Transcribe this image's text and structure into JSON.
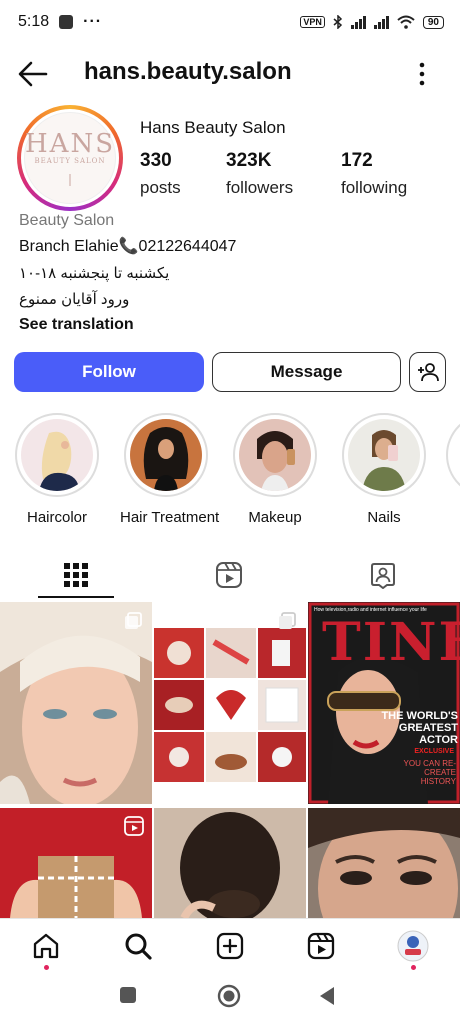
{
  "status_bar": {
    "time": "5:18",
    "dots": "···",
    "vpn": "VPN",
    "battery": "90"
  },
  "header": {
    "username": "hans.beauty.salon"
  },
  "profile": {
    "avatar_logo": "HANS",
    "avatar_sub": "BEAUTY SALON",
    "full_name": "Hans Beauty Salon",
    "stats": [
      {
        "value": "330",
        "label": "posts"
      },
      {
        "value": "323K",
        "label": "followers"
      },
      {
        "value": "172",
        "label": "following"
      }
    ],
    "category": "Beauty Salon",
    "bio_line1": "Branch Elahie📞02122644047",
    "bio_line2": "یکشنبه تا پنجشنبه ۱۸-۱۰",
    "bio_line3": "ورود آقایان ممنوع",
    "see_translation": "See translation"
  },
  "actions": {
    "follow": "Follow",
    "message": "Message"
  },
  "highlights": [
    {
      "label": "Haircolor"
    },
    {
      "label": "Hair Treatment"
    },
    {
      "label": "Makeup"
    },
    {
      "label": "Nails"
    }
  ],
  "grid_text": {
    "magazine_title": "TINE",
    "magazine_tagline": "How television,radio and internet influence your life",
    "magazine_headline": "THE WORLD'S GREATEST ACTOR",
    "magazine_exclusive": "EXCLUSIVE",
    "magazine_sub": "YOU CAN RE-CREATE HISTORY"
  },
  "colors": {
    "follow_button": "#4a5df9",
    "story_ring_gradient": [
      "#f9b233",
      "#f06a2b",
      "#d62b7c",
      "#9b30c6"
    ],
    "notification_dot": "#e0245e"
  },
  "icons": {
    "back": "arrow-left-icon",
    "more": "vertical-dots-icon",
    "add_person": "add-person-icon",
    "grid_tab": "grid-icon",
    "reels_tab": "reels-icon",
    "tagged_tab": "tagged-icon",
    "nav": [
      "home-icon",
      "search-icon",
      "create-icon",
      "reels-icon",
      "profile-icon"
    ]
  }
}
